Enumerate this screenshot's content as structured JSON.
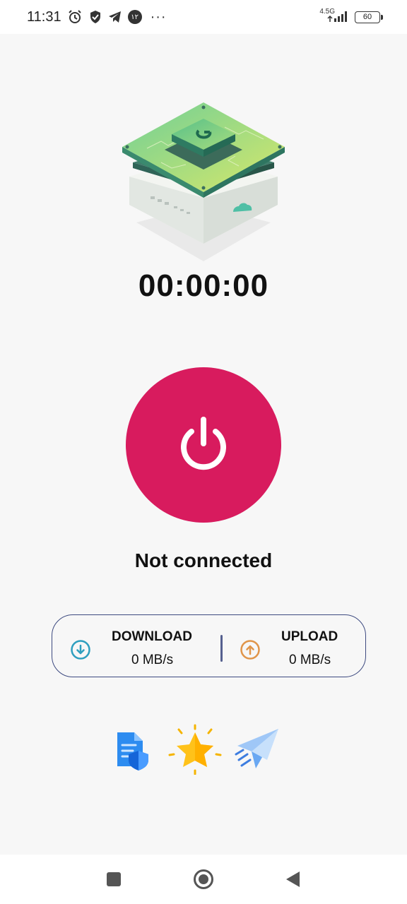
{
  "status_bar": {
    "time": "11:31",
    "network_type": "4.5G",
    "battery": "60",
    "more": "···",
    "notification_badge": "۱۲"
  },
  "timer": {
    "value": "00:00:00"
  },
  "connection": {
    "status": "Not connected",
    "power_color": "#d81b5e"
  },
  "speed": {
    "download": {
      "label": "DOWNLOAD",
      "value": "0 MB/s",
      "icon": "arrow-down-circle-icon",
      "color": "#2f9fbf"
    },
    "upload": {
      "label": "UPLOAD",
      "value": "0 MB/s",
      "icon": "arrow-up-circle-icon",
      "color": "#e0954a"
    }
  },
  "shortcuts": [
    {
      "name": "privacy-policy",
      "icon": "shield-document-icon"
    },
    {
      "name": "rate-app",
      "icon": "star-icon"
    },
    {
      "name": "share-telegram",
      "icon": "paper-plane-icon"
    }
  ],
  "nav_bar": {
    "recents": "square-icon",
    "home": "circle-icon",
    "back": "triangle-back-icon"
  }
}
